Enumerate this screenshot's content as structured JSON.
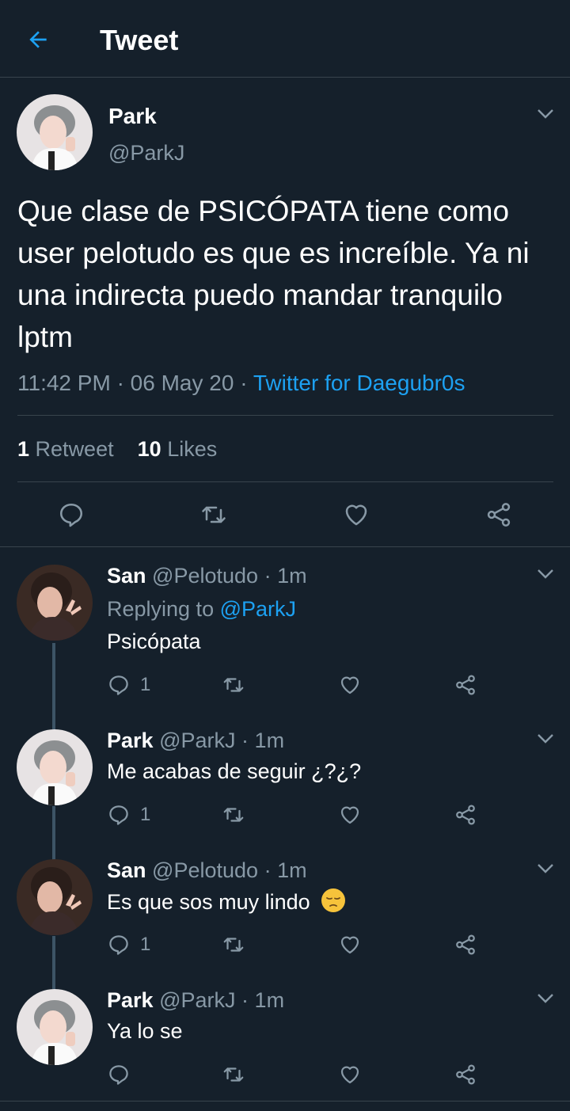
{
  "header": {
    "title": "Tweet",
    "back_icon": "arrow-left-icon"
  },
  "colors": {
    "background": "#15202b",
    "accent": "#1da1f2",
    "muted": "#8899a6",
    "divider": "#38444d"
  },
  "main_tweet": {
    "name": "Park",
    "handle": "@ParkJ",
    "text": "Que clase de PSICÓPATA tiene como user pelotudo es que es increíble. Ya ni una indirecta puedo mandar tranquilo lptm",
    "time": "11:42 PM",
    "sep1": "·",
    "date": "06 May 20",
    "sep2": "·",
    "source": "Twitter for Daegubr0s",
    "retweets_count": "1",
    "retweets_label": "Retweet",
    "likes_count": "10",
    "likes_label": "Likes"
  },
  "replies": [
    {
      "name": "San",
      "handle": "@Pelotudo",
      "sep": "·",
      "time": "1m",
      "replying_prefix": "Replying to",
      "replying_to": "@ParkJ",
      "text": "Psicópata",
      "reply_count": "1"
    },
    {
      "name": "Park",
      "handle": "@ParkJ",
      "sep": "·",
      "time": "1m",
      "text": "Me acabas de seguir ¿?¿?",
      "reply_count": "1"
    },
    {
      "name": "San",
      "handle": "@Pelotudo",
      "sep": "·",
      "time": "1m",
      "text": "Es que sos muy lindo",
      "emoji": "pensive-face-emoji",
      "reply_count": "1"
    },
    {
      "name": "Park",
      "handle": "@ParkJ",
      "sep": "·",
      "time": "1m",
      "text": "Ya lo se",
      "reply_count": ""
    }
  ]
}
